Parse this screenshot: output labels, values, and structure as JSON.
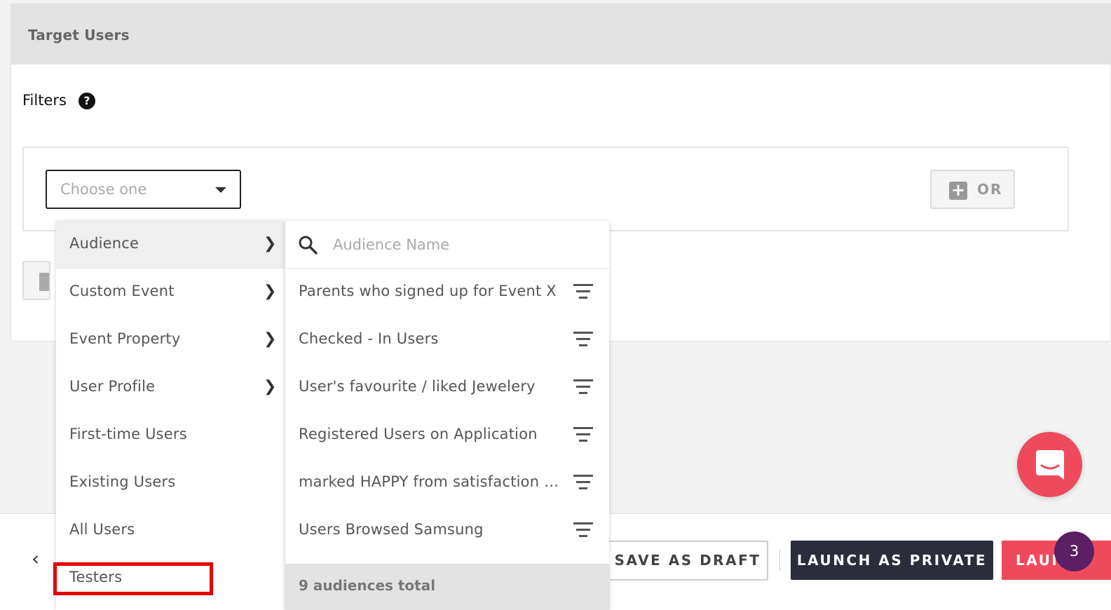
{
  "panel": {
    "title": "Target Users",
    "filters_label": "Filters",
    "help_glyph": "?"
  },
  "filter": {
    "select_placeholder": "Choose one",
    "or_label": "OR",
    "or_plus_glyph": "+"
  },
  "menu": {
    "categories": [
      {
        "label": "Audience",
        "has_submenu": true,
        "active": true
      },
      {
        "label": "Custom Event",
        "has_submenu": true
      },
      {
        "label": "Event Property",
        "has_submenu": true
      },
      {
        "label": "User Profile",
        "has_submenu": true
      },
      {
        "label": "First-time Users",
        "has_submenu": false
      },
      {
        "label": "Existing Users",
        "has_submenu": false
      },
      {
        "label": "All Users",
        "has_submenu": false
      },
      {
        "label": "Testers",
        "has_submenu": false,
        "highlighted": true
      }
    ],
    "search_placeholder": "Audience Name",
    "audiences": [
      "Parents who signed up for Event X",
      "Checked - In Users",
      "User's favourite / liked Jewelery",
      "Registered Users on Application",
      "marked HAPPY from satisfaction s...",
      "Users Browsed Samsung"
    ],
    "total_label": "9 audiences total"
  },
  "footer": {
    "back_glyph": "‹",
    "save_draft_label": "SAVE AS DRAFT",
    "launch_private_label": "LAUNCH AS PRIVATE",
    "launch_label": "LAUNCH"
  },
  "chat": {
    "badge_count": "3"
  },
  "icons": {
    "help": "help-icon",
    "caret": "chevron-down-icon",
    "plus": "plus-icon",
    "chevron_right": "chevron-right-icon",
    "search": "search-icon",
    "filter": "filter-icon",
    "chat": "chat-icon"
  },
  "colors": {
    "highlight": "#e60000",
    "launch": "#ef4a5c",
    "private": "#2b2e3a",
    "badge": "#5c1f63"
  }
}
